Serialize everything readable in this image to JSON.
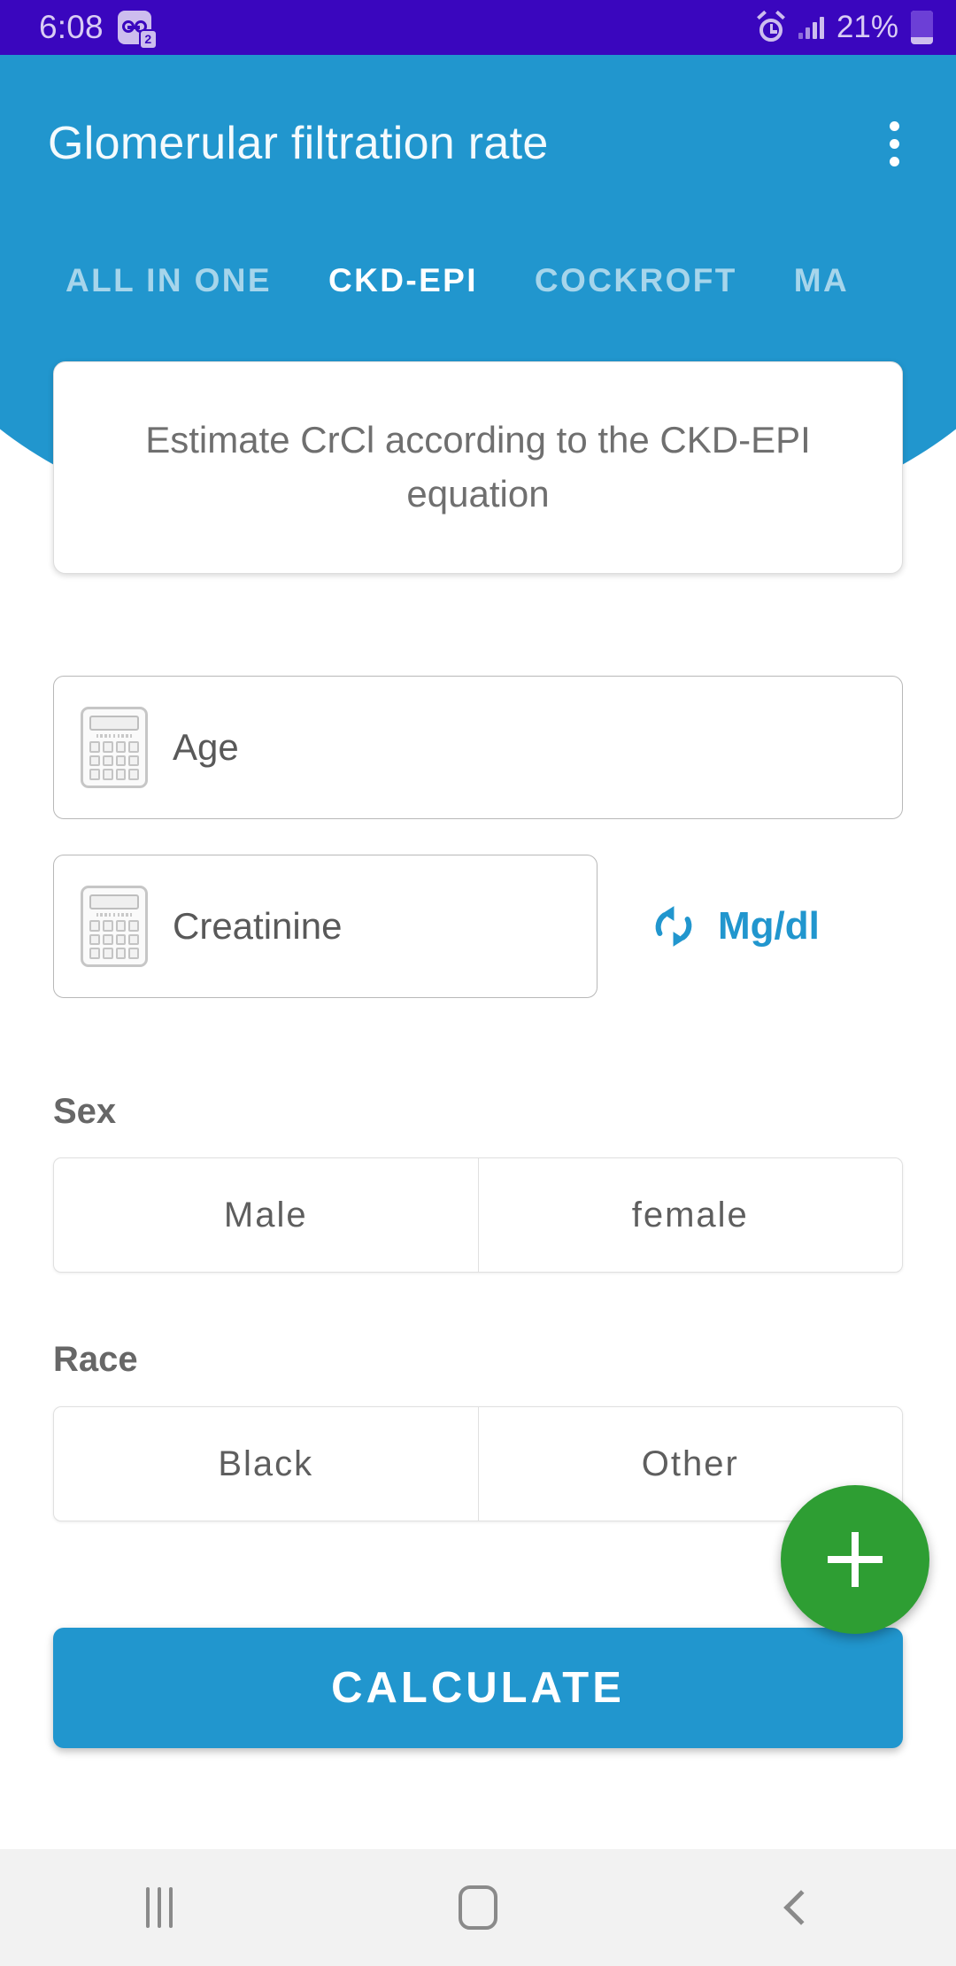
{
  "status_bar": {
    "time": "6:08",
    "voicemail_badge": "2",
    "battery_percent": "21%",
    "icons": [
      "voicemail-icon",
      "alarm-icon",
      "signal-icon",
      "battery-icon"
    ],
    "background_color": "#3A06BE",
    "foreground_color": "#CDBDEE"
  },
  "app_bar": {
    "title": "Glomerular filtration rate",
    "overflow_icon": "more-vertical-icon",
    "background_color": "#2196CE"
  },
  "tabs": [
    {
      "label": "ALL IN ONE",
      "active": false
    },
    {
      "label": "CKD-EPI",
      "active": true
    },
    {
      "label": "COCKROFT",
      "active": false
    },
    {
      "label": "MA",
      "active": false
    }
  ],
  "description": {
    "text": "Estimate CrCl according to the CKD-EPI equation"
  },
  "fields": {
    "age": {
      "placeholder": "Age",
      "value": "",
      "icon": "calculator-icon"
    },
    "creatinine": {
      "placeholder": "Creatinine",
      "value": "",
      "icon": "calculator-icon",
      "unit": "Mg/dl",
      "unit_toggle_icon": "sync-swap-icon",
      "unit_color": "#2196CE"
    }
  },
  "sex": {
    "label": "Sex",
    "options": [
      "Male",
      "female"
    ]
  },
  "race": {
    "label": "Race",
    "options": [
      "Black",
      "Other"
    ]
  },
  "calculate": {
    "label": "CALCULATE",
    "color": "#2196CE"
  },
  "fab": {
    "icon": "plus-icon",
    "color": "#2E9E33"
  },
  "nav_bar": {
    "buttons": [
      "recents-icon",
      "home-icon",
      "back-icon"
    ],
    "background_color": "#F2F2F2"
  }
}
